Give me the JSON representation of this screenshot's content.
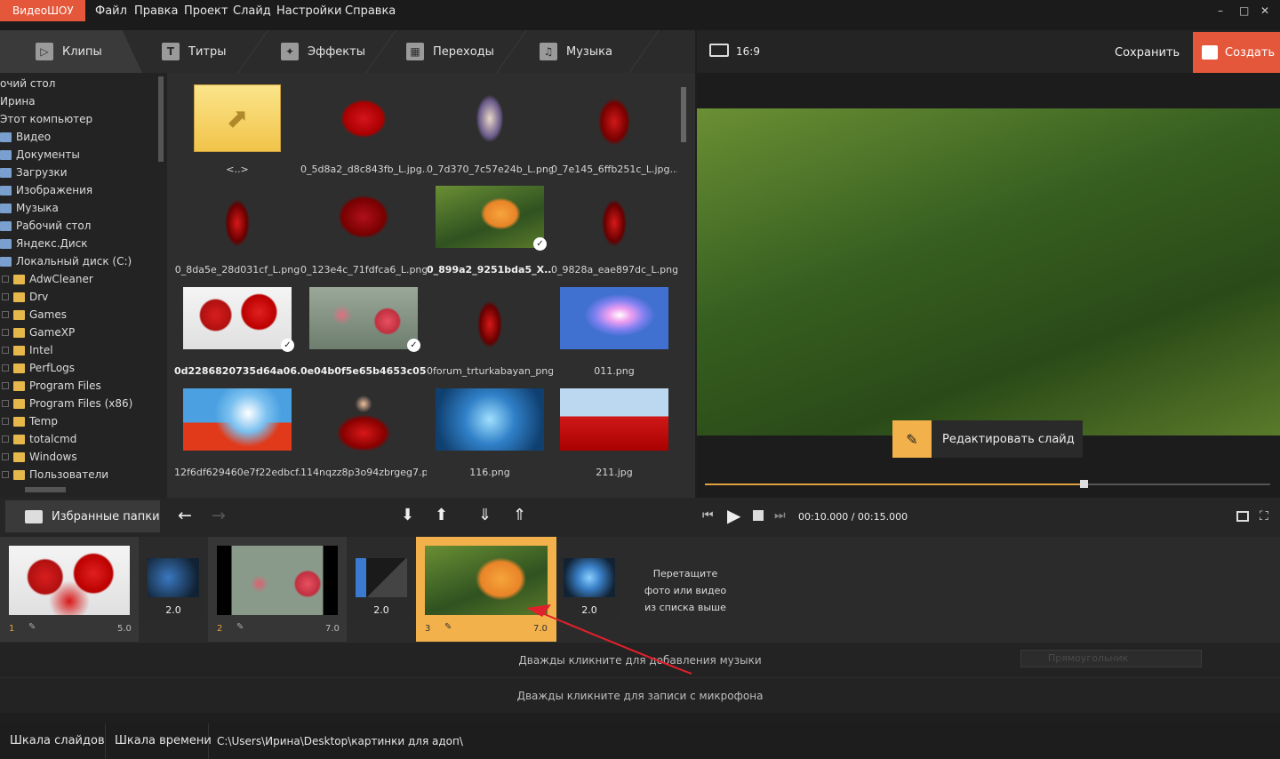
{
  "app": {
    "logo_a": "Видео",
    "logo_b": "ШОУ"
  },
  "menu": [
    "Файл",
    "Правка",
    "Проект",
    "Слайд",
    "Настройки",
    "Справка"
  ],
  "window_buttons": [
    "–",
    "□",
    "✕"
  ],
  "tabs": [
    {
      "label": "Клипы",
      "icon": "play-icon"
    },
    {
      "label": "Титры",
      "icon": "text-icon"
    },
    {
      "label": "Эффекты",
      "icon": "effects-icon"
    },
    {
      "label": "Переходы",
      "icon": "transitions-icon"
    },
    {
      "label": "Музыка",
      "icon": "music-icon"
    }
  ],
  "preview_header": {
    "aspect": "16:9",
    "save": "Сохранить",
    "create": "Создать"
  },
  "tree": [
    {
      "label": "очий стол",
      "folder": false
    },
    {
      "label": "Ирина",
      "folder": false
    },
    {
      "label": "Этот компьютер",
      "folder": false
    },
    {
      "label": "Видео",
      "folder": false
    },
    {
      "label": "Документы",
      "folder": false
    },
    {
      "label": "Загрузки",
      "folder": false
    },
    {
      "label": "Изображения",
      "folder": false
    },
    {
      "label": "Музыка",
      "folder": false
    },
    {
      "label": "Рабочий стол",
      "folder": false
    },
    {
      "label": "Яндекс.Диск",
      "folder": false
    },
    {
      "label": "Локальный диск (C:)",
      "folder": false
    },
    {
      "label": "AdwCleaner",
      "folder": true
    },
    {
      "label": "Drv",
      "folder": true
    },
    {
      "label": "Games",
      "folder": true
    },
    {
      "label": "GameXP",
      "folder": true
    },
    {
      "label": "Intel",
      "folder": true
    },
    {
      "label": "PerfLogs",
      "folder": true
    },
    {
      "label": "Program Files",
      "folder": true
    },
    {
      "label": "Program Files (x86)",
      "folder": true
    },
    {
      "label": "Temp",
      "folder": true
    },
    {
      "label": "totalcmd",
      "folder": true
    },
    {
      "label": "Windows",
      "folder": true
    },
    {
      "label": "Пользователи",
      "folder": true
    }
  ],
  "files": [
    {
      "name": "<..>",
      "kind": "up",
      "checked": false,
      "bold": false
    },
    {
      "name": "0_5d8a2_d8c843fb_L.jpg....",
      "kind": "red-woman",
      "checked": false,
      "bold": false
    },
    {
      "name": "0_7d370_7c57e24b_L.png",
      "kind": "couple",
      "checked": false,
      "bold": false
    },
    {
      "name": "0_7e145_6ffb251c_L.jpg....",
      "kind": "dancers",
      "checked": false,
      "bold": false
    },
    {
      "name": "0_8da5e_28d031cf_L.png",
      "kind": "dancer",
      "checked": false,
      "bold": false
    },
    {
      "name": "0_123e4c_71fdfca6_L.png",
      "kind": "red-rose",
      "checked": false,
      "bold": false
    },
    {
      "name": "0_899a2_9251bda5_X...",
      "kind": "yellow-rose",
      "checked": true,
      "bold": true
    },
    {
      "name": "0_9828a_eae897dc_L.png",
      "kind": "dancer",
      "checked": false,
      "bold": false
    },
    {
      "name": "0d2286820735d64a06...",
      "kind": "gerbera",
      "checked": true,
      "bold": true
    },
    {
      "name": "0e04b0f5e65b4653c05...",
      "kind": "poppy",
      "checked": true,
      "bold": true
    },
    {
      "name": "0forum_trturkabayan_png...",
      "kind": "dancer",
      "checked": false,
      "bold": false
    },
    {
      "name": "011.png",
      "kind": "light",
      "checked": false,
      "bold": false
    },
    {
      "name": "12f6df629460e7f22edbcf...",
      "kind": "field",
      "checked": false,
      "bold": false
    },
    {
      "name": "114nqzz8p3o94zbrgeg7.png",
      "kind": "red-dress",
      "checked": false,
      "bold": false
    },
    {
      "name": "116.png",
      "kind": "blue",
      "checked": false,
      "bold": false
    },
    {
      "name": "211.jpg",
      "kind": "poppies",
      "checked": false,
      "bold": false
    }
  ],
  "edit_slide": "Редактировать слайд",
  "player": {
    "time": "00:10.000 / 00:15.000",
    "progress": 0.67
  },
  "fav_folders": "Избранные папки",
  "slides": [
    {
      "num": "1",
      "dur": "5.0",
      "kind": "gerbera"
    },
    {
      "num": "2",
      "dur": "7.0",
      "kind": "poppy"
    },
    {
      "num": "3",
      "dur": "7.0",
      "kind": "yellow-rose"
    }
  ],
  "transitions": [
    "2.0",
    "2.0",
    "2.0"
  ],
  "drop_hint": [
    "Перетащите",
    "фото или видео",
    "из списка выше"
  ],
  "music_track": "Дважды кликните для добавления музыки",
  "mic_track": "Дважды кликните для записи с микрофона",
  "shape_field": "Прямоугольник",
  "bottom_tabs": [
    "Шкала слайдов",
    "Шкала времени"
  ],
  "path": "C:\\Users\\Ирина\\Desktop\\картинки для адоп\\"
}
